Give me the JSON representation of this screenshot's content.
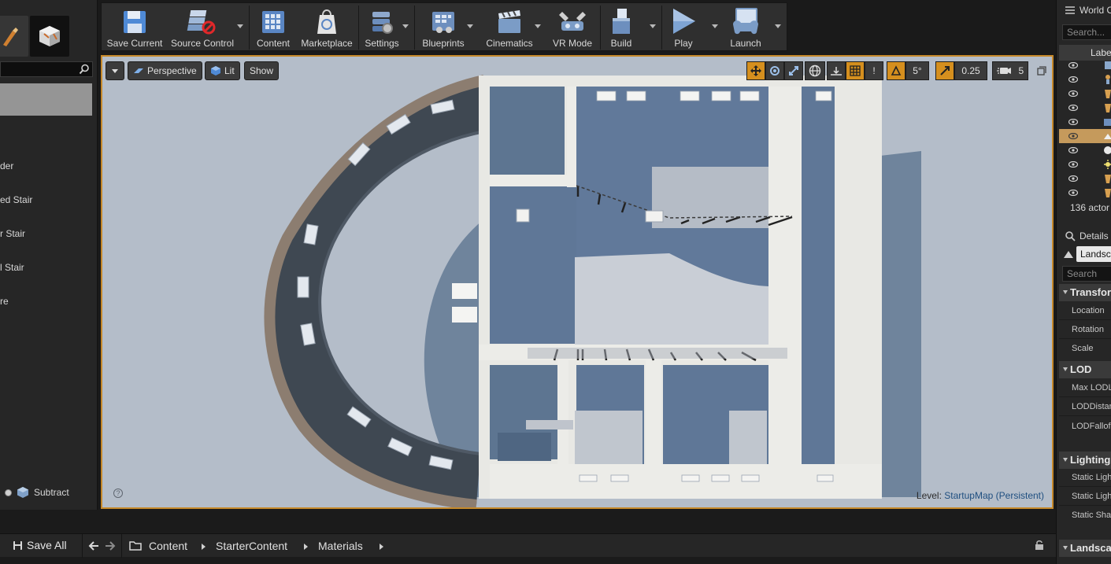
{
  "toolbar": {
    "buttons": [
      {
        "label": "Save Current",
        "icon": "floppy-disk-icon"
      },
      {
        "label": "Source Control",
        "icon": "source-control-icon"
      },
      {
        "label": "Content",
        "icon": "content-grid-icon"
      },
      {
        "label": "Marketplace",
        "icon": "marketplace-bag-icon"
      },
      {
        "label": "Settings",
        "icon": "settings-gears-icon"
      },
      {
        "label": "Blueprints",
        "icon": "blueprints-icon"
      },
      {
        "label": "Cinematics",
        "icon": "clapperboard-icon"
      },
      {
        "label": "VR Mode",
        "icon": "vr-headset-icon"
      },
      {
        "label": "Build",
        "icon": "build-blocks-icon"
      },
      {
        "label": "Play",
        "icon": "play-icon"
      },
      {
        "label": "Launch",
        "icon": "gamepad-launch-icon"
      }
    ]
  },
  "place_panel": {
    "items": [
      "der",
      "ed Stair",
      "r Stair",
      "l Stair",
      "re"
    ],
    "bottom_option": "Subtract"
  },
  "viewport": {
    "view_mode": "Perspective",
    "lighting_mode": "Lit",
    "show_label": "Show",
    "rotation_snap": "5°",
    "scale_snap": "0.25",
    "camera_speed": "5",
    "level_prefix": "Level:",
    "level_name": "StartupMap (Persistent)",
    "help_glyph": "?",
    "surface_snap_glyph": "!"
  },
  "world_outliner": {
    "tab_title": "World O",
    "search_placeholder": "Search...",
    "label_header": "Label",
    "actor_count": "136 actor"
  },
  "details": {
    "tab_title": "Details",
    "selected_object": "Landsc",
    "search_placeholder": "Search",
    "sections": {
      "transform": "Transfor",
      "lod": "LOD",
      "lighting": "Lighting",
      "landscape": "Landscap"
    },
    "transform_props": [
      "Location",
      "Rotation",
      "Scale"
    ],
    "lod_props": [
      "Max LODL",
      "LODDistar",
      "LODFallof"
    ],
    "lighting_props": [
      "Static Ligh",
      "Static Ligh",
      "Static Sha"
    ]
  },
  "content_browser": {
    "save_all": "Save All",
    "path": [
      "Content",
      "StarterContent",
      "Materials"
    ]
  },
  "colors": {
    "viewport_border": "#c6892a",
    "toggle_on": "#d58f1e",
    "selected_row": "#c59a5c"
  }
}
